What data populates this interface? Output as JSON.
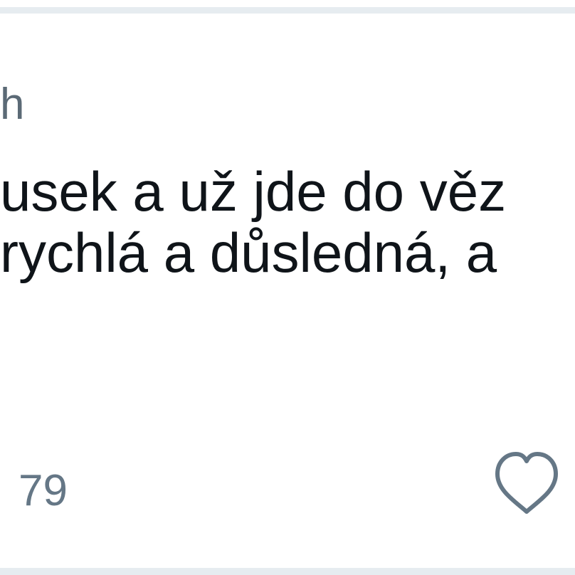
{
  "post": {
    "author_name": "h",
    "body_lines": [
      "usek a už jde do věz",
      "rychlá a důsledná, a"
    ],
    "action_count": "79"
  },
  "icons": {
    "like": "heart-icon"
  },
  "colors": {
    "divider": "#e6ecf0",
    "body_text": "#0f1419",
    "secondary_text": "#657786",
    "icon_stroke": "#657786"
  }
}
